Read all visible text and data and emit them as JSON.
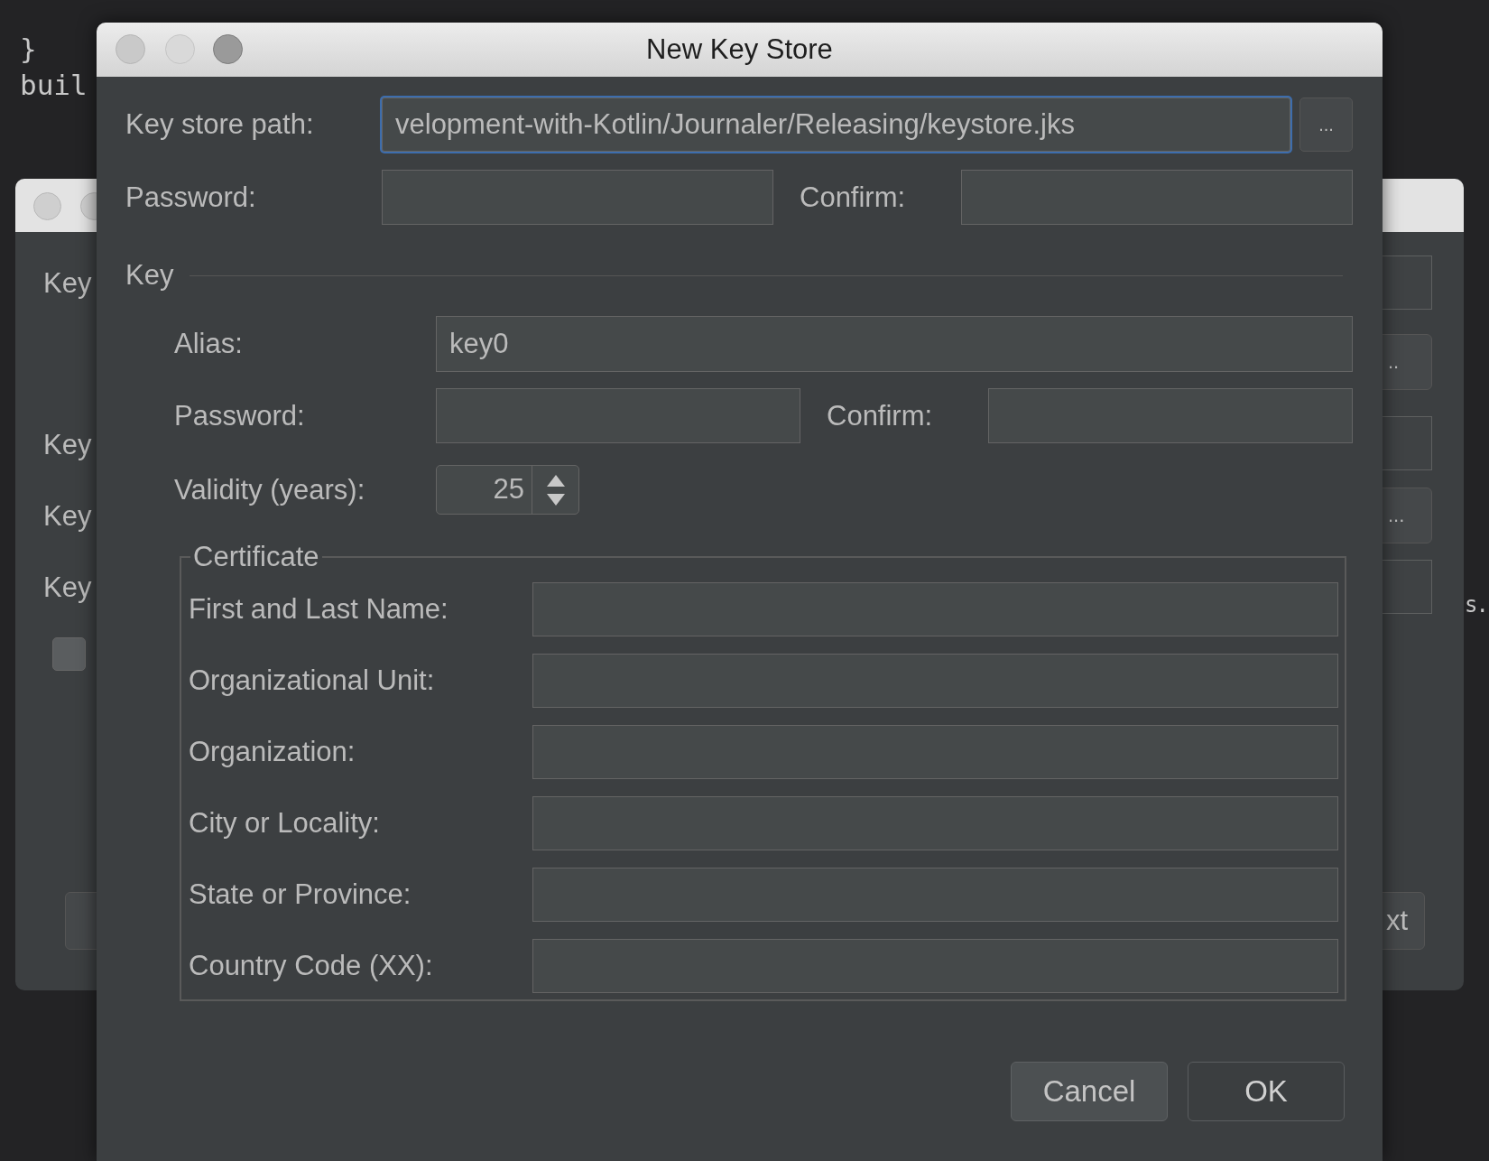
{
  "editor": {
    "fragments": [
      {
        "text": "}"
      },
      {
        "text": "buil"
      },
      {
        "text": "s."
      }
    ]
  },
  "background_dialog": {
    "labels": [
      "Key",
      "Key",
      "Key",
      "Key"
    ],
    "checkbox": {
      "checked": false
    },
    "browse_buttons": [
      "..",
      "..."
    ],
    "next_button": "xt"
  },
  "dialog": {
    "title": "New Key Store",
    "key_store_path": {
      "label": "Key store path:",
      "value": "velopment-with-Kotlin/Journaler/Releasing/keystore.jks",
      "focused": true,
      "browse": "..."
    },
    "password": {
      "label": "Password:",
      "confirm_label": "Confirm:"
    },
    "key": {
      "heading": "Key",
      "alias": {
        "label": "Alias:",
        "value": "key0"
      },
      "password": {
        "label": "Password:",
        "confirm_label": "Confirm:"
      },
      "validity": {
        "label": "Validity (years):",
        "value": "25"
      },
      "certificate": {
        "heading": "Certificate",
        "fields": [
          {
            "label": "First and Last Name:"
          },
          {
            "label": "Organizational Unit:"
          },
          {
            "label": "Organization:"
          },
          {
            "label": "City or Locality:"
          },
          {
            "label": "State or Province:"
          },
          {
            "label": "Country Code (XX):"
          }
        ]
      }
    },
    "buttons": [
      {
        "label": "Cancel",
        "default": false
      },
      {
        "label": "OK",
        "default": true
      }
    ]
  }
}
